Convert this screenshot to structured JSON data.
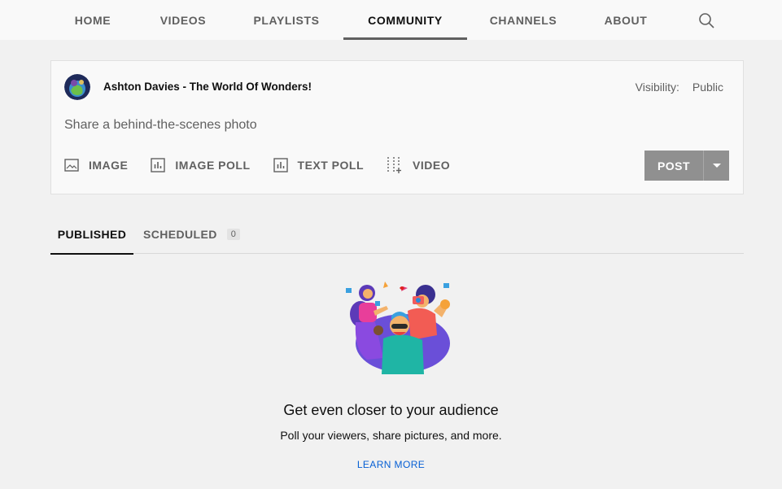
{
  "nav": {
    "tabs": [
      {
        "label": "HOME"
      },
      {
        "label": "VIDEOS"
      },
      {
        "label": "PLAYLISTS"
      },
      {
        "label": "COMMUNITY"
      },
      {
        "label": "CHANNELS"
      },
      {
        "label": "ABOUT"
      }
    ],
    "active_tab": "COMMUNITY",
    "search_icon": "search-icon"
  },
  "composer": {
    "channel_name": "Ashton Davies - The World Of Wonders!",
    "visibility_label": "Visibility:",
    "visibility_value": "Public",
    "placeholder": "Share a behind-the-scenes photo",
    "tools": [
      {
        "label": "IMAGE",
        "icon": "image-icon"
      },
      {
        "label": "IMAGE POLL",
        "icon": "poll-icon"
      },
      {
        "label": "TEXT POLL",
        "icon": "poll-icon"
      },
      {
        "label": "VIDEO",
        "icon": "video-add-icon"
      }
    ],
    "post_label": "POST",
    "post_menu_icon": "caret-down-icon"
  },
  "subtabs": {
    "published_label": "PUBLISHED",
    "scheduled_label": "SCHEDULED",
    "scheduled_count": "0"
  },
  "empty_state": {
    "title": "Get even closer to your audience",
    "subtitle": "Poll your viewers, share pictures, and more.",
    "link": "LEARN MORE"
  },
  "colors": {
    "accent_link": "#065fd4",
    "post_button": "#909090",
    "background": "#f1f1f1"
  }
}
